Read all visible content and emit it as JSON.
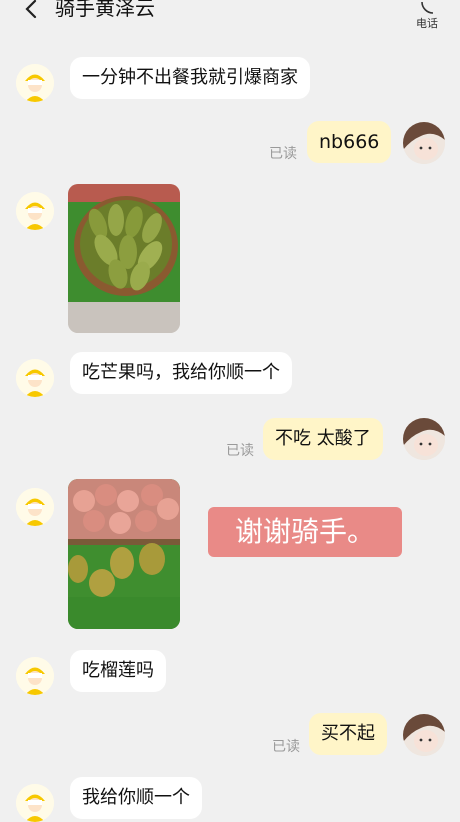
{
  "header": {
    "title": "骑手黄泽云",
    "phone_label": "电话"
  },
  "messages": [
    {
      "from": "rider",
      "text": "一分钟不出餐我就引爆商家"
    },
    {
      "from": "me",
      "text": "nb666",
      "status": "已读"
    },
    {
      "from": "rider",
      "type": "image",
      "content": "mangoes"
    },
    {
      "from": "rider",
      "text": "吃芒果吗，我给你顺一个"
    },
    {
      "from": "me",
      "text": "不吃 太酸了",
      "status": "已读"
    },
    {
      "from": "rider",
      "type": "image",
      "content": "durians"
    },
    {
      "from": "rider",
      "text": "吃榴莲吗"
    },
    {
      "from": "me",
      "text": "买不起",
      "status": "已读"
    },
    {
      "from": "rider",
      "text": "我给你顺一个"
    }
  ],
  "overlay_caption": "谢谢骑手。",
  "colors": {
    "background": "#f0f0f0",
    "my_bubble": "#fff5c8",
    "caption_bg": "#e98a87"
  },
  "icons": {
    "back": "chevron-left-icon",
    "phone": "phone-icon"
  }
}
